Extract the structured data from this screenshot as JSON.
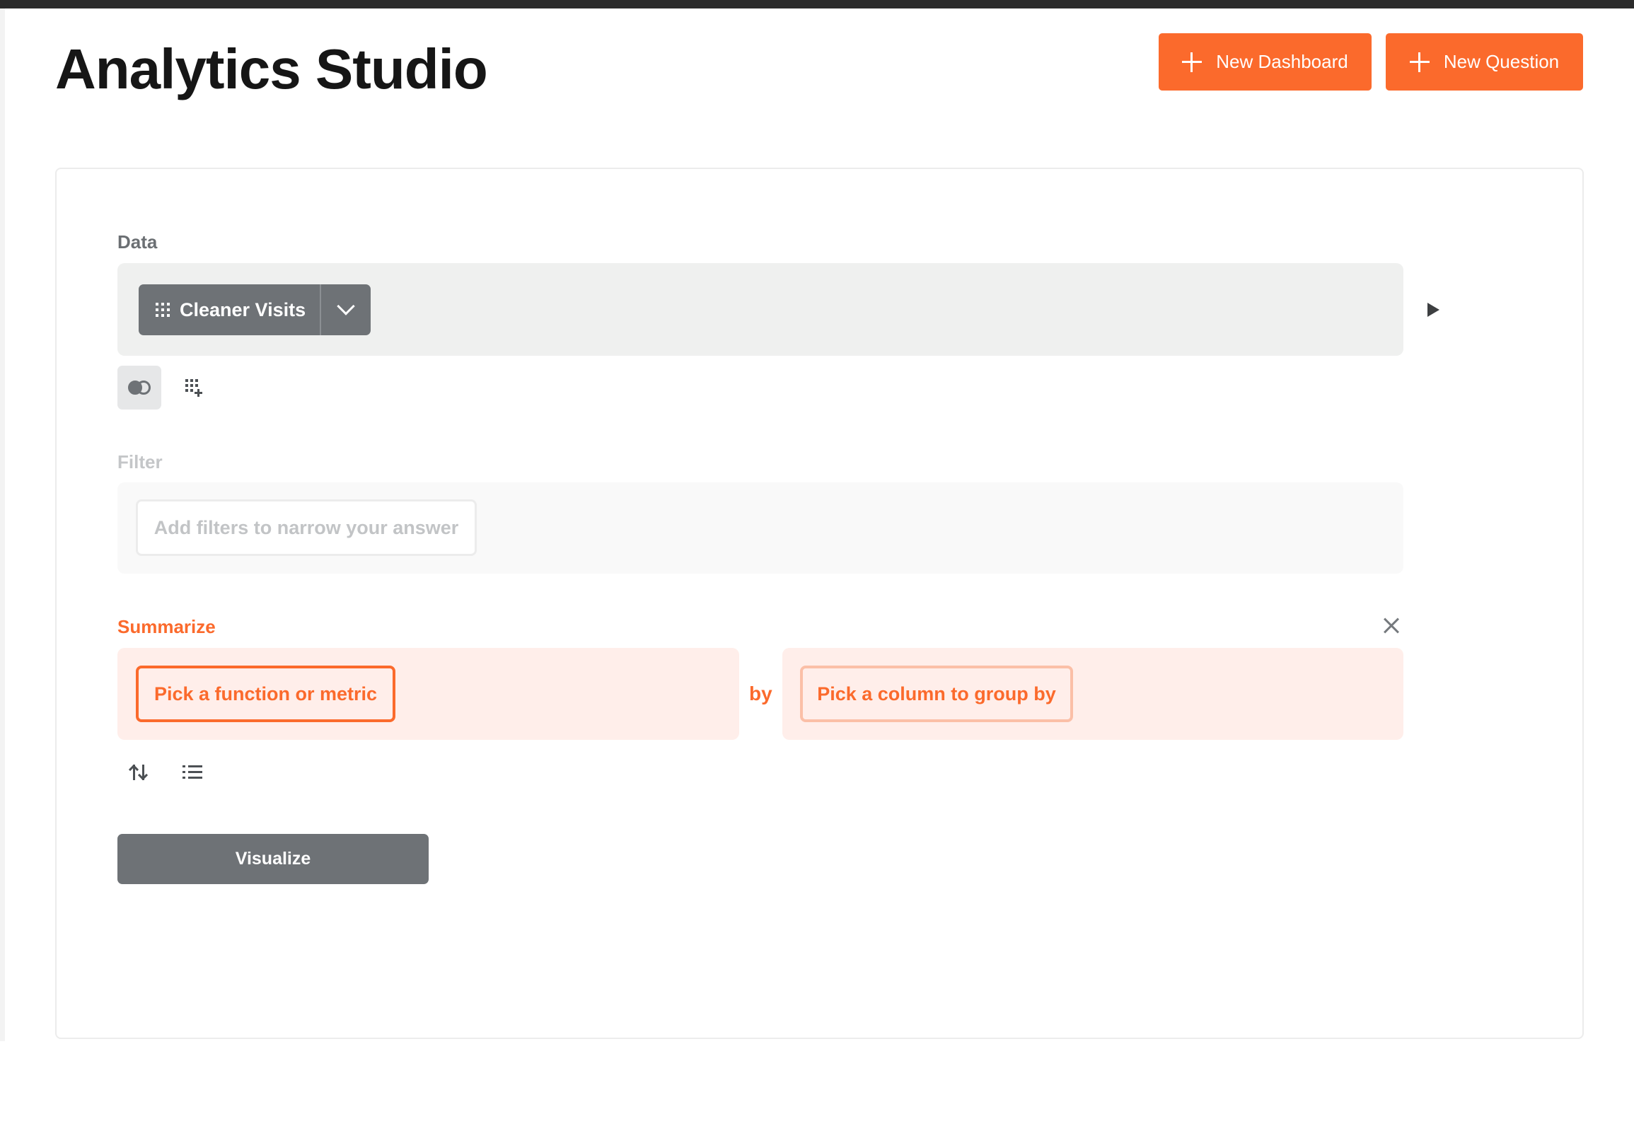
{
  "page": {
    "title": "Analytics Studio"
  },
  "header": {
    "new_dashboard_label": "New Dashboard",
    "new_question_label": "New Question"
  },
  "editor": {
    "data": {
      "label": "Data",
      "table_name": "Cleaner Visits"
    },
    "filter": {
      "label": "Filter",
      "placeholder": "Add filters to narrow your answer"
    },
    "summarize": {
      "label": "Summarize",
      "metric_placeholder": "Pick a function or metric",
      "by_word": "by",
      "groupby_placeholder": "Pick a column to group by"
    },
    "visualize_label": "Visualize"
  },
  "icons": {
    "add": "plus-icon",
    "table": "grid-icon",
    "dropdown": "chevron-down-icon",
    "preview": "play-icon",
    "join": "join-icon",
    "custom_column": "custom-column-icon",
    "remove": "close-icon",
    "sort": "sort-icon",
    "limit": "list-icon"
  },
  "colors": {
    "accent": "#fb6a2c",
    "accent_light": "#ffeeea",
    "neutral_button": "#6e7276",
    "data_bg": "#eff0ef"
  }
}
